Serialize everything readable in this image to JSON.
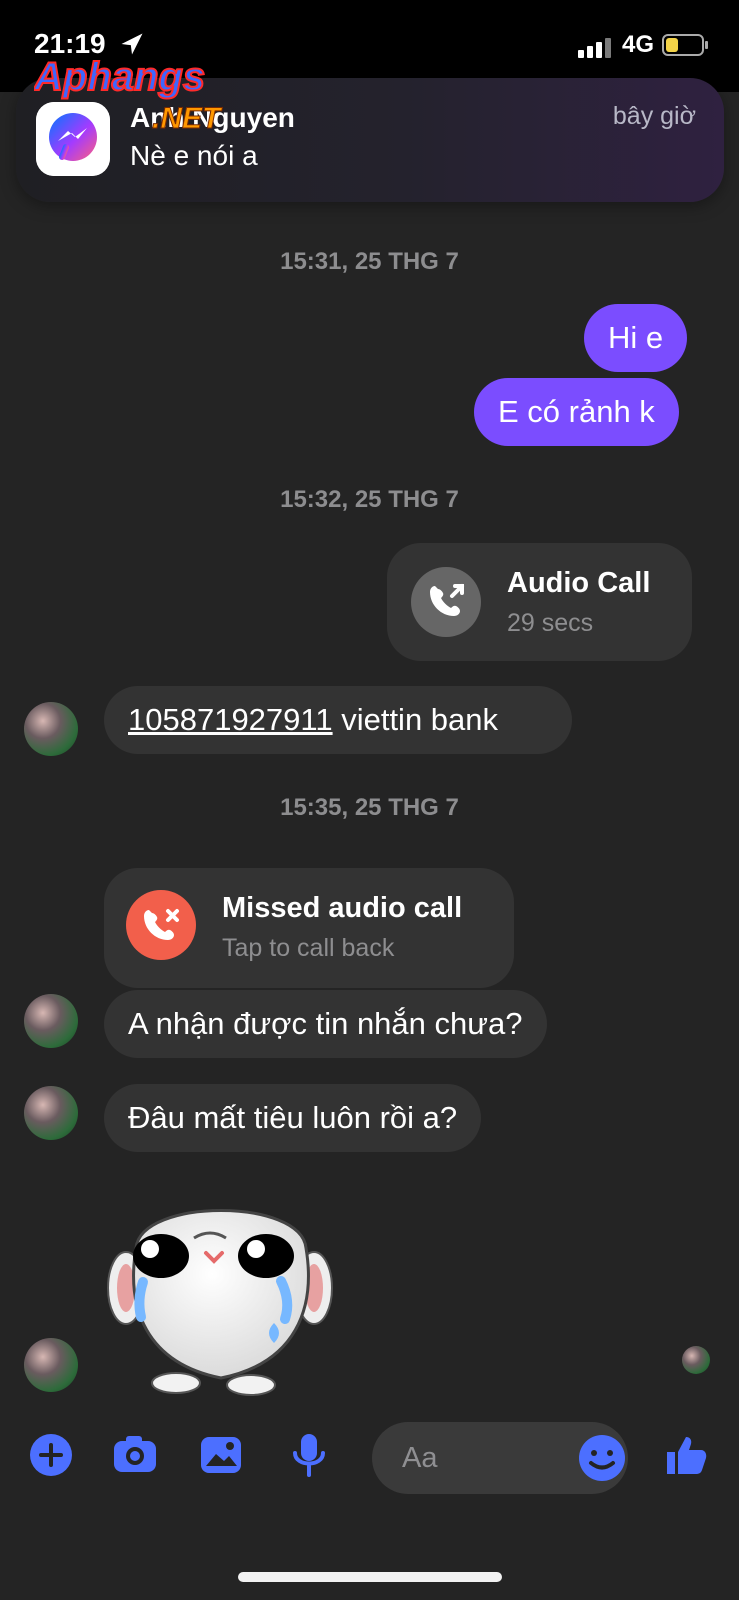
{
  "status_bar": {
    "time": "21:19",
    "network": "4G"
  },
  "watermark": {
    "brand_top": "Aphangs",
    "brand_bottom": ".NET"
  },
  "notification": {
    "sender": "Anh Nguyen",
    "message": "Nè e nói a",
    "time": "bây giờ"
  },
  "chat": {
    "separators": [
      "15:31, 25 THG 7",
      "15:32, 25 THG 7",
      "15:35, 25 THG 7"
    ],
    "sent_messages": [
      "Hi e",
      "E có rảnh k"
    ],
    "audio_call": {
      "title": "Audio Call",
      "subtitle": "29 secs"
    },
    "bank_message": {
      "number": "105871927911",
      "text": " viettin bank"
    },
    "missed_call": {
      "title": "Missed audio call",
      "subtitle": "Tap to call back"
    },
    "received_messages": [
      "A nhận được tin nhắn chưa?",
      "Đâu mất tiêu luôn rồi a?"
    ]
  },
  "composer": {
    "placeholder": "Aa"
  },
  "colors": {
    "sent_bubble": "#7b4dff",
    "received_bubble": "#333333",
    "icon_blue": "#4c6fff",
    "missed_red": "#f25f4b"
  },
  "icons": {
    "add": "plus-circle-icon",
    "camera": "camera-icon",
    "gallery": "image-icon",
    "mic": "microphone-icon",
    "emoji": "emoji-icon",
    "like": "thumbs-up-icon",
    "call": "phone-icon",
    "messenger": "messenger-icon"
  }
}
